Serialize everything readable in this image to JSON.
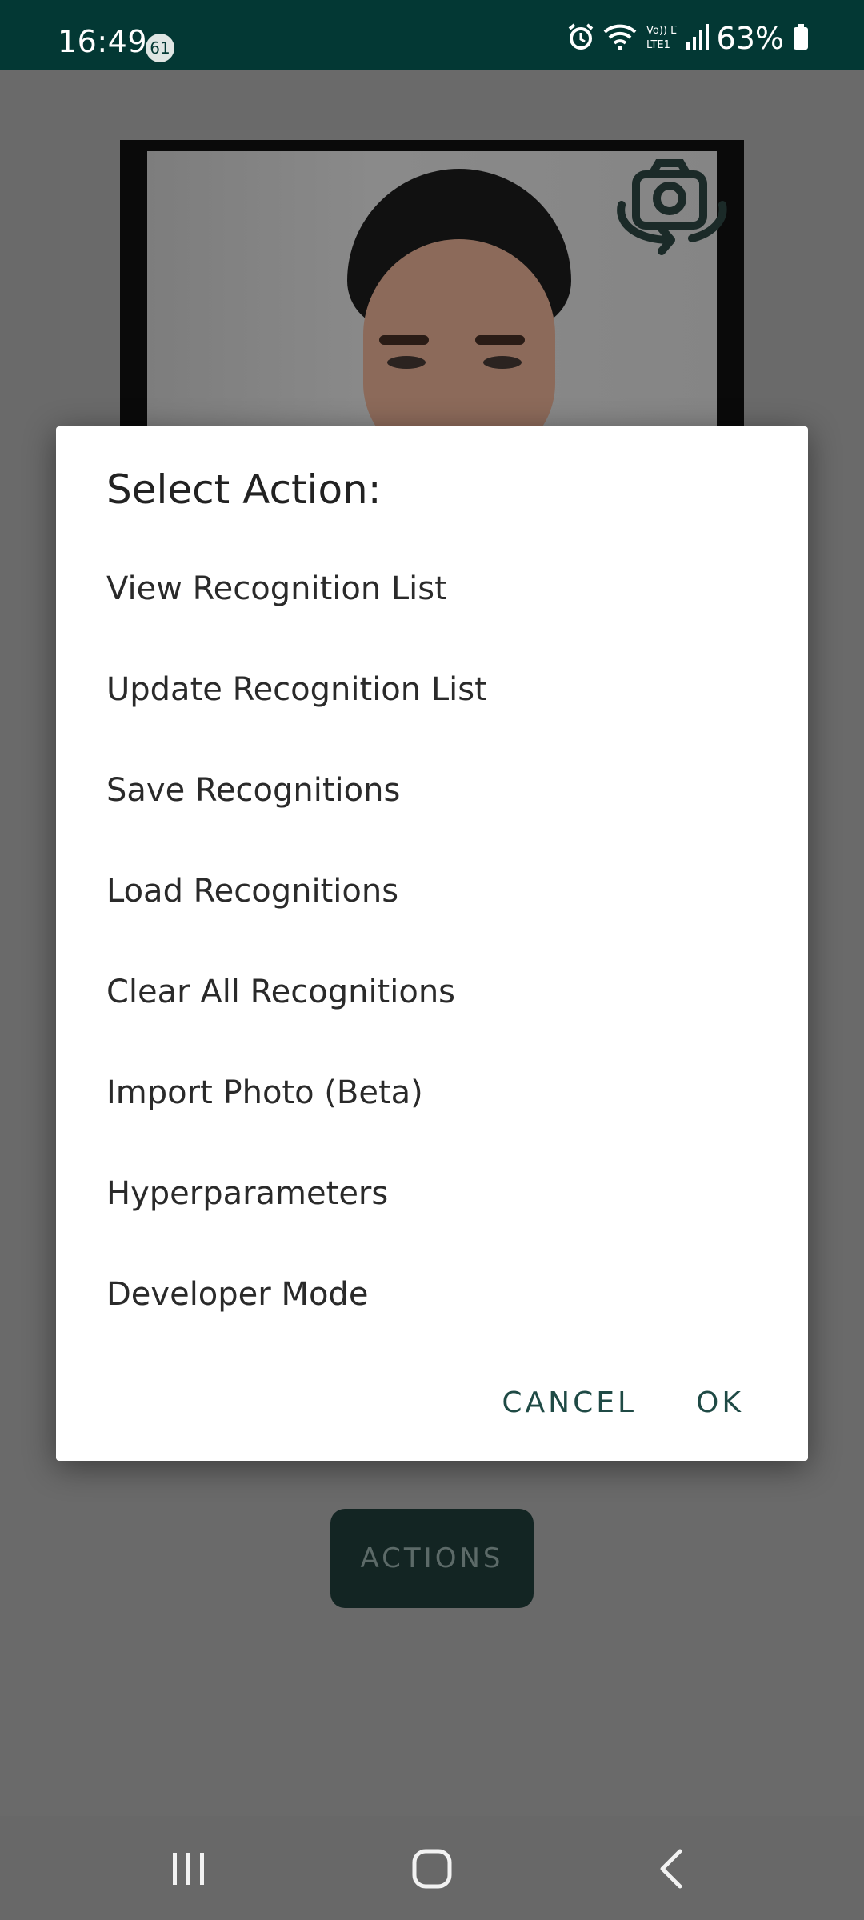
{
  "status_bar": {
    "time": "16:49",
    "notification_count": "61",
    "network_label": "Vo)) LTE1",
    "battery_percent": "63%",
    "colors": {
      "background": "#033834",
      "text": "#ffffff"
    }
  },
  "camera": {
    "switch_icon": "switch-camera-icon"
  },
  "dialog": {
    "title": "Select Action:",
    "options": [
      {
        "label": "View Recognition List"
      },
      {
        "label": "Update Recognition List"
      },
      {
        "label": "Save Recognitions"
      },
      {
        "label": "Load Recognitions"
      },
      {
        "label": "Clear All Recognitions"
      },
      {
        "label": "Import Photo (Beta)"
      },
      {
        "label": "Hyperparameters"
      },
      {
        "label": "Developer Mode"
      }
    ],
    "cancel_label": "CANCEL",
    "ok_label": "OK",
    "accent_color": "#1f4a45"
  },
  "actions_button": {
    "label": "ACTIONS"
  },
  "navigation": {
    "recents_icon": "recents-icon",
    "home_icon": "home-icon",
    "back_icon": "back-icon"
  }
}
